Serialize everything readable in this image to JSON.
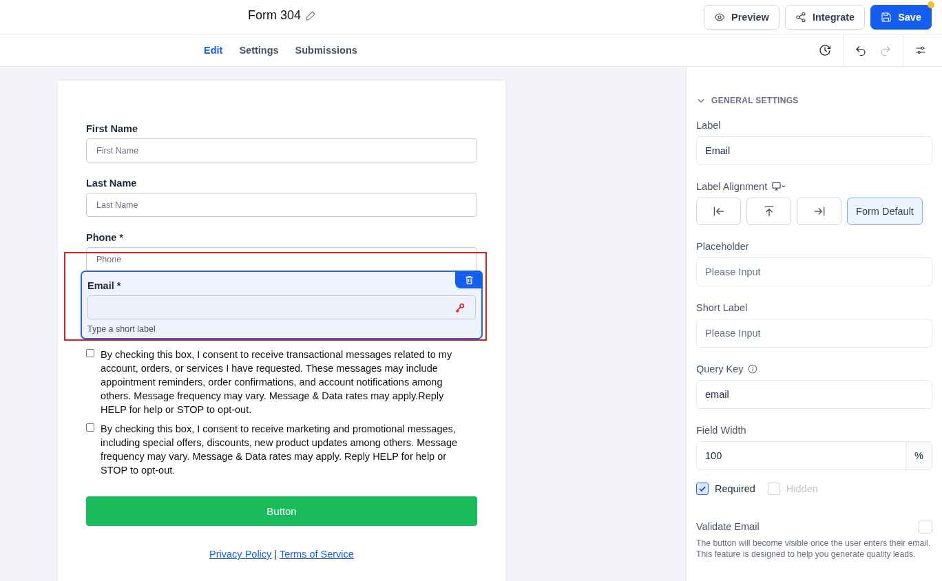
{
  "header": {
    "title": "Form 304",
    "buttons": [
      {
        "kind": "preview",
        "label": "Preview"
      },
      {
        "kind": "integrate",
        "label": "Integrate"
      },
      {
        "kind": "save",
        "label": "Save",
        "unsaved": true
      }
    ]
  },
  "tabs": [
    {
      "label": "Edit",
      "selected": true
    },
    {
      "label": "Settings",
      "selected": false
    },
    {
      "label": "Submissions",
      "selected": false
    }
  ],
  "toolbar": [
    {
      "kind": "history",
      "disabled": false
    },
    {
      "kind": "undo",
      "disabled": false
    },
    {
      "kind": "redo",
      "disabled": true
    },
    {
      "kind": "tune",
      "disabled": false
    }
  ],
  "form": {
    "fields": [
      {
        "label": "First Name",
        "placeholder": "First Name",
        "selected": false
      },
      {
        "label": "Last Name",
        "placeholder": "Last Name",
        "selected": false
      },
      {
        "label": "Phone *",
        "placeholder": "Phone",
        "selected": false
      },
      {
        "label": "Email *",
        "selected": true,
        "highlighted": true,
        "hint": "Type a short label"
      }
    ],
    "consents": [
      {
        "text": "By checking this box, I consent to receive transactional messages related to my account, orders, or services I have requested. These messages may include appointment reminders, order confirmations, and account notifications among others. Message frequency may vary. Message & Data rates may apply.Reply HELP for help or STOP to opt-out.",
        "checked": false
      },
      {
        "text": "By checking this box, I consent to receive marketing and promotional messages, including special offers, discounts, new product updates among others. Message frequency may vary. Message & Data rates may apply. Reply HELP for help or STOP to opt-out.",
        "checked": false
      }
    ],
    "submit": "Button",
    "links": [
      "Privacy Policy",
      "Terms of Service"
    ],
    "separator": "|"
  },
  "settings": {
    "section": {
      "title": "GENERAL SETTINGS",
      "expanded": true
    },
    "label": {
      "label": "Label",
      "value": "Email"
    },
    "alignment": {
      "label": "Label Alignment",
      "options": [
        {
          "kind": "left",
          "selected": false
        },
        {
          "kind": "top",
          "selected": false
        },
        {
          "kind": "right",
          "selected": false
        },
        {
          "kind": "default",
          "label": "Form Default",
          "selected": true
        }
      ]
    },
    "placeholder": {
      "label": "Placeholder",
      "placeholder": "Please Input"
    },
    "short_label": {
      "label": "Short Label",
      "placeholder": "Please Input"
    },
    "query_key": {
      "label": "Query Key",
      "value": "email"
    },
    "field_width": {
      "label": "Field Width",
      "value": "100",
      "unit": "%"
    },
    "flags": [
      {
        "label": "Required",
        "checked": true,
        "disabled": false
      },
      {
        "label": "Hidden",
        "checked": false,
        "disabled": true
      }
    ],
    "validate": {
      "label": "Validate Email",
      "checked": false,
      "description": "The button will become visible once the user enters their email. This feature is designed to help you generate quality leads."
    }
  }
}
